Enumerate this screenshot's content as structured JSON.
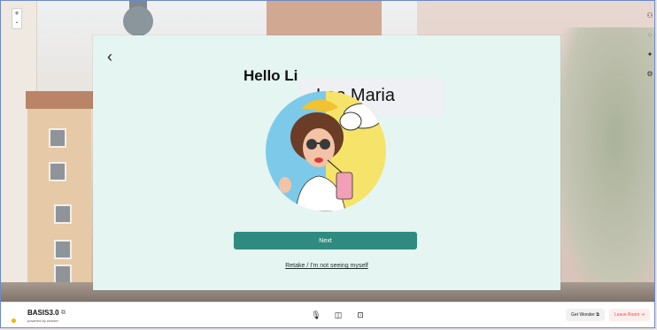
{
  "zoom": {
    "plus": "+",
    "minus": "-"
  },
  "modal": {
    "back_label": "‹",
    "hello": "Hello Li",
    "name_value": "Leo Maria",
    "next_label": "Next",
    "retake_label": "Retake / I'm not seeing myself"
  },
  "bottom": {
    "brand": "BASIS3.0",
    "powered": "powered by wonder",
    "get_wonder": "Get Wonder",
    "leave_room": "Leave Room"
  },
  "colors": {
    "accent": "#2f8b7f",
    "modal_bg": "#e4f5f2",
    "leave": "#e54b4b",
    "brand_dot": "#f4b400"
  }
}
